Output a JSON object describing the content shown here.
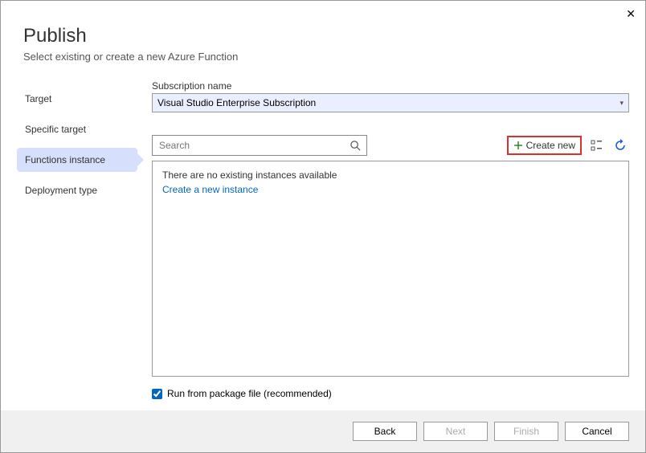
{
  "header": {
    "title": "Publish",
    "subtitle": "Select existing or create a new Azure Function"
  },
  "steps": {
    "items": [
      {
        "label": "Target"
      },
      {
        "label": "Specific target"
      },
      {
        "label": "Functions instance"
      },
      {
        "label": "Deployment type"
      }
    ],
    "active_index": 2
  },
  "subscription": {
    "label": "Subscription name",
    "value": "Visual Studio Enterprise Subscription"
  },
  "search": {
    "placeholder": "Search",
    "value": ""
  },
  "toolbar": {
    "create_new_label": "Create new"
  },
  "listbox": {
    "empty_message": "There are no existing instances available",
    "create_link_label": "Create a new instance"
  },
  "options": {
    "run_from_package_label": "Run from package file (recommended)",
    "run_from_package_checked": true
  },
  "footer": {
    "back": "Back",
    "next": "Next",
    "finish": "Finish",
    "cancel": "Cancel"
  }
}
